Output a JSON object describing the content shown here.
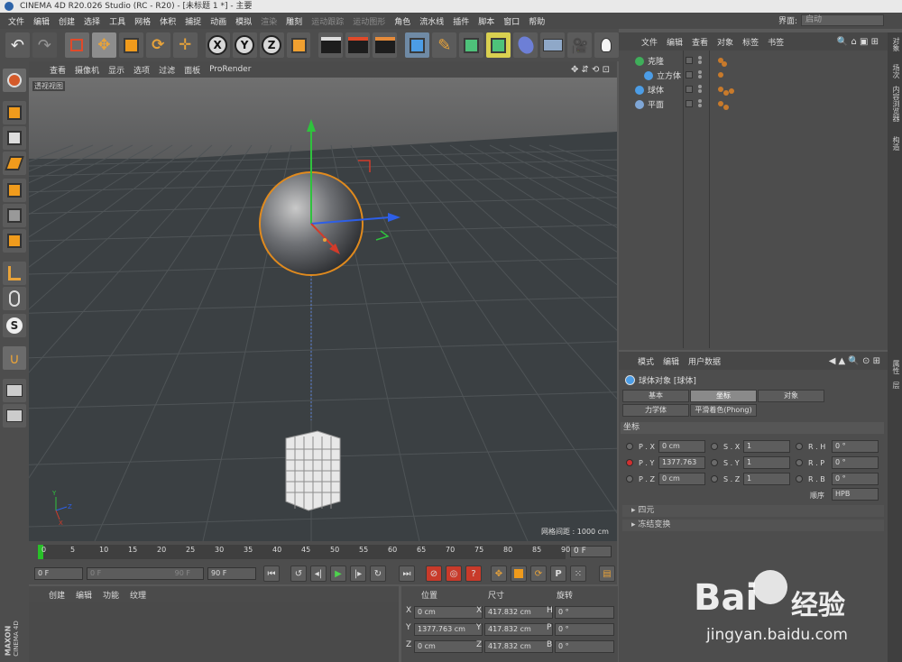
{
  "window": {
    "title": "CINEMA 4D R20.026 Studio (RC - R20) - [未标题 1 *] - 主要"
  },
  "menubar": {
    "items": [
      {
        "label": "文件",
        "dim": false
      },
      {
        "label": "编辑",
        "dim": false
      },
      {
        "label": "创建",
        "dim": false
      },
      {
        "label": "选择",
        "dim": false
      },
      {
        "label": "工具",
        "dim": false
      },
      {
        "label": "网格",
        "dim": false
      },
      {
        "label": "体积",
        "dim": false
      },
      {
        "label": "捕捉",
        "dim": false
      },
      {
        "label": "动画",
        "dim": false
      },
      {
        "label": "模拟",
        "dim": false
      },
      {
        "label": "渲染",
        "dim": true
      },
      {
        "label": "雕刻",
        "dim": false
      },
      {
        "label": "运动跟踪",
        "dim": true
      },
      {
        "label": "运动图形",
        "dim": true
      },
      {
        "label": "角色",
        "dim": false
      },
      {
        "label": "流水线",
        "dim": false
      },
      {
        "label": "插件",
        "dim": false
      },
      {
        "label": "脚本",
        "dim": false
      },
      {
        "label": "窗口",
        "dim": false
      },
      {
        "label": "帮助",
        "dim": false
      }
    ]
  },
  "layout": {
    "label": "界面:",
    "value": "启动"
  },
  "viewport": {
    "menu": [
      "查看",
      "摄像机",
      "显示",
      "选项",
      "过滤",
      "面板",
      "ProRender"
    ],
    "label": "透视视图",
    "grid_spacing": "网格间距 : 1000 cm",
    "colors": {
      "bg": "#3d4245",
      "sphere_outline": "#e08a1e",
      "axis_x": "#d23b2a",
      "axis_y": "#2fc23d",
      "axis_z": "#2d5fe8"
    }
  },
  "timeline": {
    "ticks": [
      "0",
      "5",
      "10",
      "15",
      "20",
      "25",
      "30",
      "35",
      "40",
      "45",
      "50",
      "55",
      "60",
      "65",
      "70",
      "75",
      "80",
      "85",
      "90"
    ],
    "current_frame": "0 F"
  },
  "transport": {
    "start": "0 F",
    "range_start": "0 F",
    "range_end": "90 F",
    "end": "90 F"
  },
  "material_bar": {
    "items": [
      "创建",
      "编辑",
      "功能",
      "纹理"
    ]
  },
  "coordinates": {
    "headers": [
      "位置",
      "尺寸",
      "旋转"
    ],
    "rows": [
      {
        "axis": "X",
        "pos": "0 cm",
        "size_axis": "X",
        "size": "417.832 cm",
        "rot_axis": "H",
        "rot": "0 °"
      },
      {
        "axis": "Y",
        "pos": "1377.763 cm",
        "size_axis": "Y",
        "size": "417.832 cm",
        "rot_axis": "P",
        "rot": "0 °"
      },
      {
        "axis": "Z",
        "pos": "0 cm",
        "size_axis": "Z",
        "size": "417.832 cm",
        "rot_axis": "B",
        "rot": "0 °"
      }
    ]
  },
  "object_manager": {
    "menu": [
      "文件",
      "编辑",
      "查看",
      "对象",
      "标签",
      "书签"
    ],
    "objects": [
      {
        "name": "克隆",
        "icon_color": "#3fae5a"
      },
      {
        "name": "立方体",
        "icon_color": "#4c9de6"
      },
      {
        "name": "球体",
        "icon_color": "#4c9de6"
      },
      {
        "name": "平面",
        "icon_color": "#7fa6d6"
      }
    ]
  },
  "side_tabs": [
    "对象",
    "场次",
    "内容浏览器",
    "构造",
    "属性",
    "层"
  ],
  "attributes": {
    "menu": [
      "模式",
      "编辑",
      "用户数据"
    ],
    "title": "球体对象 [球体]",
    "tabs": [
      "基本",
      "坐标",
      "对象",
      "力学体",
      "平滑着色(Phong)"
    ],
    "section": "坐标",
    "params": [
      {
        "l": "P . X",
        "v": "0 cm",
        "sl": "S . X",
        "sv": "1",
        "rl": "R . H",
        "rv": "0 °"
      },
      {
        "l": "P . Y",
        "v": "1377.763",
        "sl": "S . Y",
        "sv": "1",
        "rl": "R . P",
        "rv": "0 °"
      },
      {
        "l": "P . Z",
        "v": "0 cm",
        "sl": "S . Z",
        "sv": "1",
        "rl": "R . B",
        "rv": "0 °"
      }
    ],
    "order_label": "顺序",
    "order_value": "HPB",
    "folds": [
      "四元",
      "冻结变换"
    ]
  },
  "watermark": {
    "brand": "Bai",
    "brand2": "百度",
    "suffix": "经验",
    "url": "jingyan.baidu.com"
  },
  "maxon": {
    "line1": "MAXON",
    "line2": "CINEMA 4D"
  }
}
